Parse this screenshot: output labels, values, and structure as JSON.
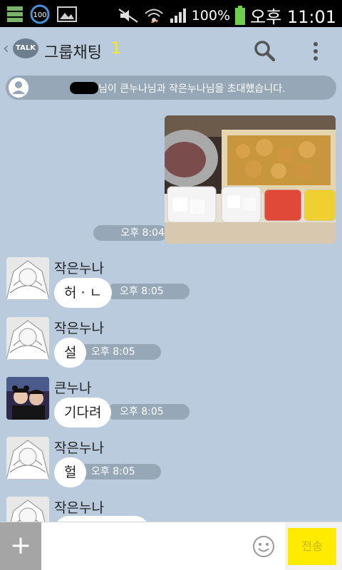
{
  "status_bar": {
    "battery": "100%",
    "time": "오후 11:01",
    "badge": "100"
  },
  "header": {
    "back": "‹",
    "logo": "TALK",
    "title": "그룹채팅",
    "member_count": "1"
  },
  "notice": {
    "text": "님이 큰누나님과 작은누나님을 초대했습니다."
  },
  "photo_message": {
    "time": "오후 8:04"
  },
  "messages": [
    {
      "sender": "작은누나",
      "text": "허 · ㄴ",
      "time": "오후 8:05"
    },
    {
      "sender": "작은누나",
      "text": "설",
      "time": "오후 8:05"
    },
    {
      "sender": "큰누나",
      "text": "기다려",
      "time": "오후 8:05"
    },
    {
      "sender": "작은누나",
      "text": "헐",
      "time": "오후 8:05"
    },
    {
      "sender": "작은누나",
      "text": "",
      "time": ""
    }
  ],
  "input": {
    "plus": "+",
    "placeholder": "",
    "send_label": "전송"
  },
  "colors": {
    "background": "#b9cbdd",
    "send": "#ffeb00",
    "pill": "#96a8b8"
  }
}
